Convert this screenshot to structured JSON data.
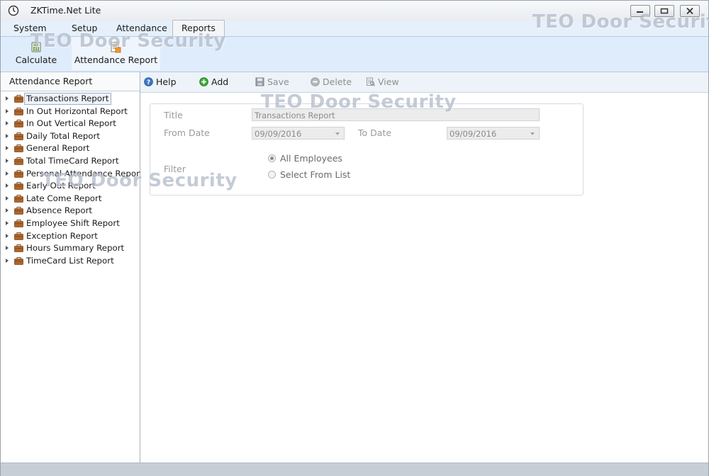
{
  "window": {
    "title": "ZKTime.Net Lite"
  },
  "menu": {
    "items": [
      "System",
      "Setup",
      "Attendance",
      "Reports"
    ],
    "active": "Reports"
  },
  "ribbon": {
    "calculate_label": "Calculate",
    "attendance_report_label": "Attendance Report"
  },
  "left_panel": {
    "header": "Attendance Report",
    "items": [
      "Transactions  Report",
      "In Out Horizontal Report",
      "In Out Vertical Report",
      "Daily Total Report",
      "General Report",
      "Total TimeCard Report",
      "Personal Attendance Report",
      "Early Out Report",
      "Late Come Report",
      "Absence Report",
      "Employee Shift Report",
      "Exception Report",
      "Hours Summary Report",
      "TimeCard List Report"
    ],
    "selected_index": 0
  },
  "toolbar": {
    "help": "Help",
    "add": "Add",
    "save": "Save",
    "delete": "Delete",
    "view": "View"
  },
  "form": {
    "title_label": "Title",
    "title_value": "Transactions  Report",
    "from_date_label": "From Date",
    "from_date_value": "09/09/2016",
    "to_date_label": "To Date",
    "to_date_value": "09/09/2016",
    "filter_label": "Filter",
    "filter_options": [
      "All Employees",
      "Select From List"
    ],
    "filter_selected": "All Employees"
  },
  "watermark": {
    "text": "TEO Door Security"
  }
}
